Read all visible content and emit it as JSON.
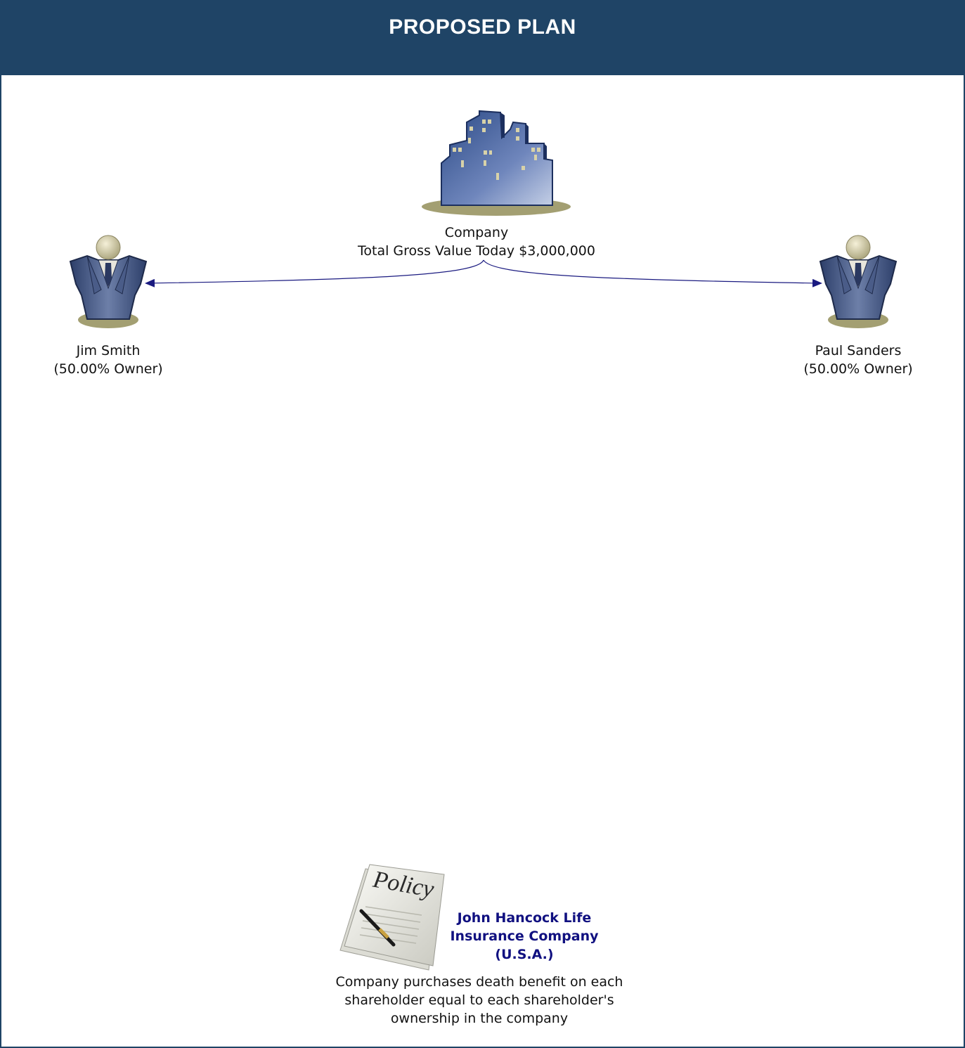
{
  "header": {
    "title": "PROPOSED PLAN"
  },
  "company": {
    "name": "Company",
    "value_line": "Total Gross Value Today $3,000,000"
  },
  "owners": [
    {
      "name": "Jim Smith",
      "share": "(50.00% Owner)"
    },
    {
      "name": "Paul Sanders",
      "share": "(50.00% Owner)"
    }
  ],
  "policy": {
    "image_text": "Policy",
    "insurer_lines": [
      "John Hancock Life",
      "Insurance Company",
      "(U.S.A.)"
    ],
    "caption_lines": [
      "Company purchases death benefit on each",
      "shareholder equal to each shareholder's",
      "ownership in the company"
    ]
  },
  "colors": {
    "header": "#1f4466",
    "arrow": "#1a1a80",
    "insurer_text": "#101080",
    "figure_blue": "#3a4f7e",
    "base_olive": "#a39f72"
  },
  "icons": [
    "city-buildings-icon",
    "businessman-icon",
    "policy-document-icon"
  ]
}
